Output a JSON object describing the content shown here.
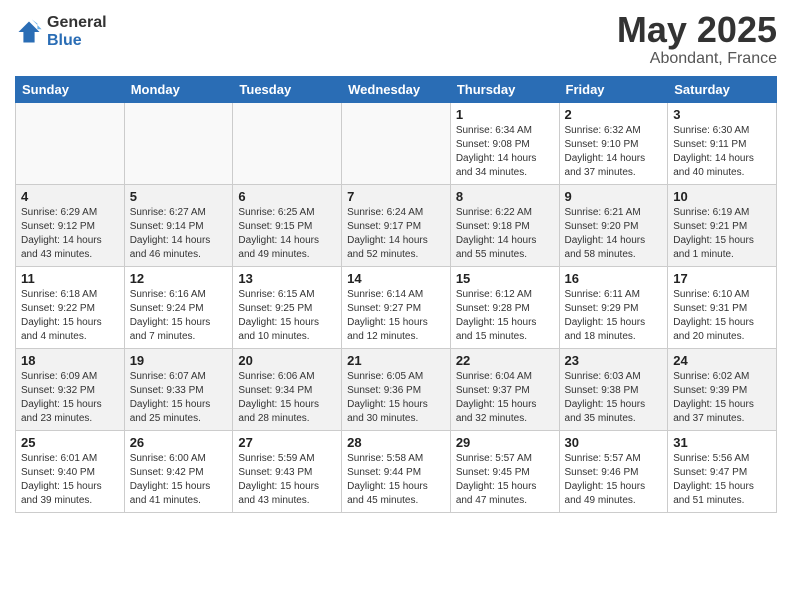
{
  "logo": {
    "general": "General",
    "blue": "Blue"
  },
  "title": {
    "month": "May 2025",
    "location": "Abondant, France"
  },
  "days_of_week": [
    "Sunday",
    "Monday",
    "Tuesday",
    "Wednesday",
    "Thursday",
    "Friday",
    "Saturday"
  ],
  "weeks": [
    {
      "alt": false,
      "days": [
        {
          "num": "",
          "info": ""
        },
        {
          "num": "",
          "info": ""
        },
        {
          "num": "",
          "info": ""
        },
        {
          "num": "",
          "info": ""
        },
        {
          "num": "1",
          "info": "Sunrise: 6:34 AM\nSunset: 9:08 PM\nDaylight: 14 hours\nand 34 minutes."
        },
        {
          "num": "2",
          "info": "Sunrise: 6:32 AM\nSunset: 9:10 PM\nDaylight: 14 hours\nand 37 minutes."
        },
        {
          "num": "3",
          "info": "Sunrise: 6:30 AM\nSunset: 9:11 PM\nDaylight: 14 hours\nand 40 minutes."
        }
      ]
    },
    {
      "alt": true,
      "days": [
        {
          "num": "4",
          "info": "Sunrise: 6:29 AM\nSunset: 9:12 PM\nDaylight: 14 hours\nand 43 minutes."
        },
        {
          "num": "5",
          "info": "Sunrise: 6:27 AM\nSunset: 9:14 PM\nDaylight: 14 hours\nand 46 minutes."
        },
        {
          "num": "6",
          "info": "Sunrise: 6:25 AM\nSunset: 9:15 PM\nDaylight: 14 hours\nand 49 minutes."
        },
        {
          "num": "7",
          "info": "Sunrise: 6:24 AM\nSunset: 9:17 PM\nDaylight: 14 hours\nand 52 minutes."
        },
        {
          "num": "8",
          "info": "Sunrise: 6:22 AM\nSunset: 9:18 PM\nDaylight: 14 hours\nand 55 minutes."
        },
        {
          "num": "9",
          "info": "Sunrise: 6:21 AM\nSunset: 9:20 PM\nDaylight: 14 hours\nand 58 minutes."
        },
        {
          "num": "10",
          "info": "Sunrise: 6:19 AM\nSunset: 9:21 PM\nDaylight: 15 hours\nand 1 minute."
        }
      ]
    },
    {
      "alt": false,
      "days": [
        {
          "num": "11",
          "info": "Sunrise: 6:18 AM\nSunset: 9:22 PM\nDaylight: 15 hours\nand 4 minutes."
        },
        {
          "num": "12",
          "info": "Sunrise: 6:16 AM\nSunset: 9:24 PM\nDaylight: 15 hours\nand 7 minutes."
        },
        {
          "num": "13",
          "info": "Sunrise: 6:15 AM\nSunset: 9:25 PM\nDaylight: 15 hours\nand 10 minutes."
        },
        {
          "num": "14",
          "info": "Sunrise: 6:14 AM\nSunset: 9:27 PM\nDaylight: 15 hours\nand 12 minutes."
        },
        {
          "num": "15",
          "info": "Sunrise: 6:12 AM\nSunset: 9:28 PM\nDaylight: 15 hours\nand 15 minutes."
        },
        {
          "num": "16",
          "info": "Sunrise: 6:11 AM\nSunset: 9:29 PM\nDaylight: 15 hours\nand 18 minutes."
        },
        {
          "num": "17",
          "info": "Sunrise: 6:10 AM\nSunset: 9:31 PM\nDaylight: 15 hours\nand 20 minutes."
        }
      ]
    },
    {
      "alt": true,
      "days": [
        {
          "num": "18",
          "info": "Sunrise: 6:09 AM\nSunset: 9:32 PM\nDaylight: 15 hours\nand 23 minutes."
        },
        {
          "num": "19",
          "info": "Sunrise: 6:07 AM\nSunset: 9:33 PM\nDaylight: 15 hours\nand 25 minutes."
        },
        {
          "num": "20",
          "info": "Sunrise: 6:06 AM\nSunset: 9:34 PM\nDaylight: 15 hours\nand 28 minutes."
        },
        {
          "num": "21",
          "info": "Sunrise: 6:05 AM\nSunset: 9:36 PM\nDaylight: 15 hours\nand 30 minutes."
        },
        {
          "num": "22",
          "info": "Sunrise: 6:04 AM\nSunset: 9:37 PM\nDaylight: 15 hours\nand 32 minutes."
        },
        {
          "num": "23",
          "info": "Sunrise: 6:03 AM\nSunset: 9:38 PM\nDaylight: 15 hours\nand 35 minutes."
        },
        {
          "num": "24",
          "info": "Sunrise: 6:02 AM\nSunset: 9:39 PM\nDaylight: 15 hours\nand 37 minutes."
        }
      ]
    },
    {
      "alt": false,
      "days": [
        {
          "num": "25",
          "info": "Sunrise: 6:01 AM\nSunset: 9:40 PM\nDaylight: 15 hours\nand 39 minutes."
        },
        {
          "num": "26",
          "info": "Sunrise: 6:00 AM\nSunset: 9:42 PM\nDaylight: 15 hours\nand 41 minutes."
        },
        {
          "num": "27",
          "info": "Sunrise: 5:59 AM\nSunset: 9:43 PM\nDaylight: 15 hours\nand 43 minutes."
        },
        {
          "num": "28",
          "info": "Sunrise: 5:58 AM\nSunset: 9:44 PM\nDaylight: 15 hours\nand 45 minutes."
        },
        {
          "num": "29",
          "info": "Sunrise: 5:57 AM\nSunset: 9:45 PM\nDaylight: 15 hours\nand 47 minutes."
        },
        {
          "num": "30",
          "info": "Sunrise: 5:57 AM\nSunset: 9:46 PM\nDaylight: 15 hours\nand 49 minutes."
        },
        {
          "num": "31",
          "info": "Sunrise: 5:56 AM\nSunset: 9:47 PM\nDaylight: 15 hours\nand 51 minutes."
        }
      ]
    }
  ]
}
